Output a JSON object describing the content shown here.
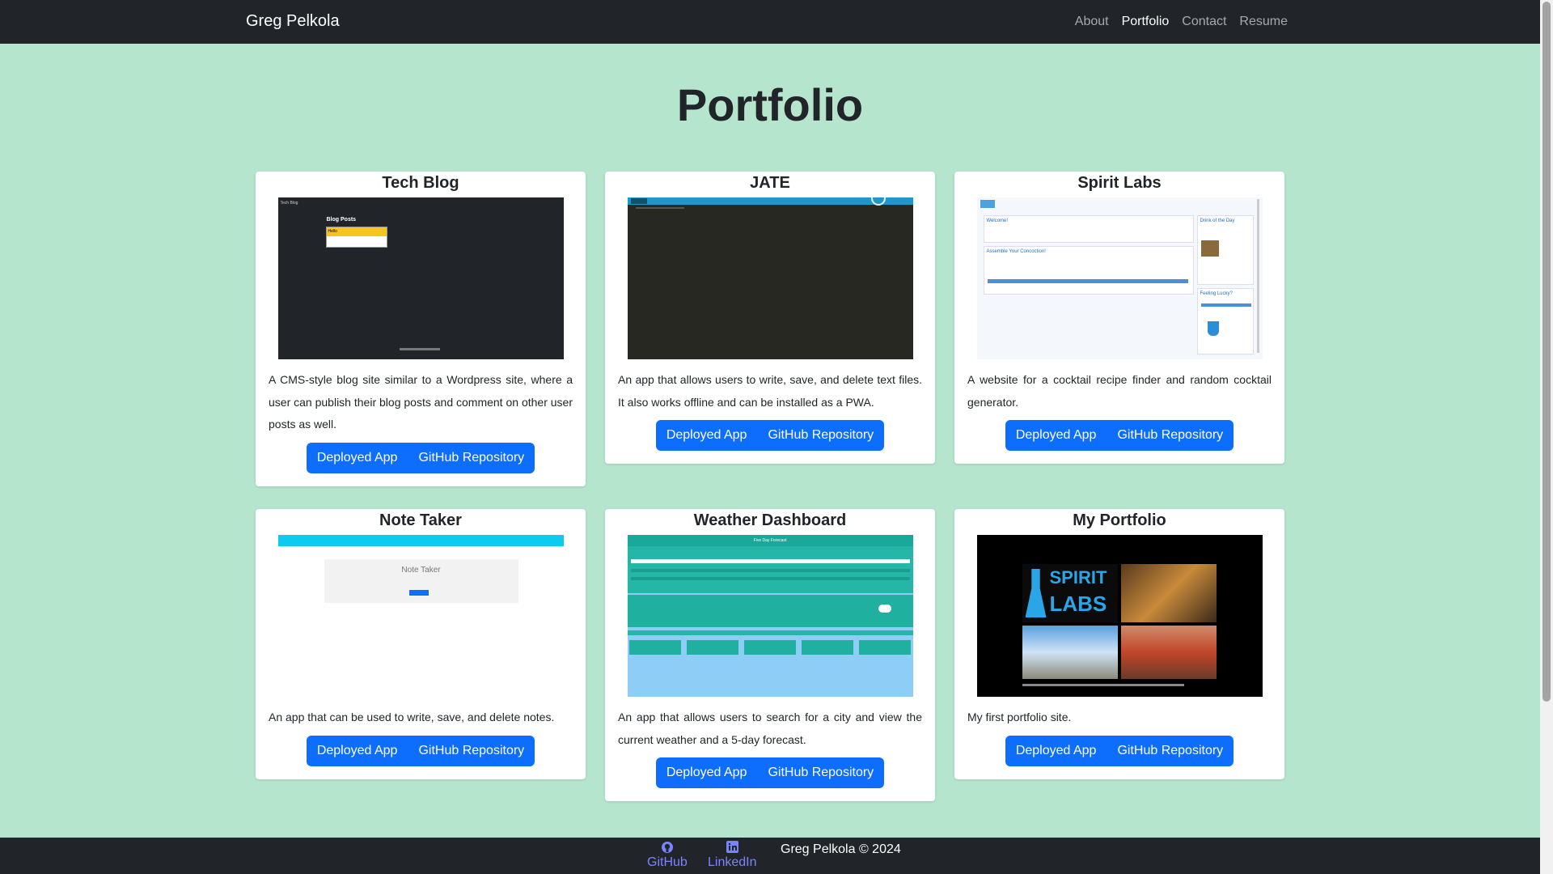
{
  "navbar": {
    "brand": "Greg Pelkola",
    "links": [
      {
        "label": "About",
        "active": false
      },
      {
        "label": "Portfolio",
        "active": true
      },
      {
        "label": "Contact",
        "active": false
      },
      {
        "label": "Resume",
        "active": false
      }
    ]
  },
  "page": {
    "title": "Portfolio"
  },
  "projects": [
    {
      "title": "Tech Blog",
      "description": "A CMS-style blog site similar to a Wordpress site, where a user can publish their blog posts and comment on other user posts as well.",
      "deployed_label": "Deployed App",
      "repo_label": "GitHub Repository",
      "preview": {
        "nav_text": "Tech Blog",
        "heading": "Blog Posts",
        "item": "Hello"
      }
    },
    {
      "title": "JATE",
      "description": "An app that allows users to write, save, and delete text files. It also works offline and can be installed as a PWA.",
      "deployed_label": "Deployed App",
      "repo_label": "GitHub Repository"
    },
    {
      "title": "Spirit Labs",
      "description": "A website for a cocktail recipe finder and random cocktail generator.",
      "deployed_label": "Deployed App",
      "repo_label": "GitHub Repository",
      "preview": {
        "welcome": "Welcome!",
        "assemble": "Assemble Your Concoction!",
        "drink": "Drink of the Day",
        "lucky": "Feeling Lucky?"
      }
    },
    {
      "title": "Note Taker",
      "description": "An app that can be used to write, save, and delete notes.",
      "deployed_label": "Deployed App",
      "repo_label": "GitHub Repository",
      "preview": {
        "heading": "Note Taker"
      }
    },
    {
      "title": "Weather Dashboard",
      "description": "An app that allows users to search for a city and view the current weather and a 5-day forecast.",
      "deployed_label": "Deployed App",
      "repo_label": "GitHub Repository",
      "preview": {
        "heading": "Five Day Forecast"
      }
    },
    {
      "title": "My Portfolio",
      "description": "My first portfolio site.",
      "deployed_label": "Deployed App",
      "repo_label": "GitHub Repository",
      "preview": {
        "logo_line1": "SPIRIT",
        "logo_line2": "LABS"
      }
    }
  ],
  "footer": {
    "github_label": "GitHub",
    "linkedin_label": "LinkedIn",
    "copyright": "Greg Pelkola © 2024",
    "link_color": "#7b84ff"
  },
  "colors": {
    "page_bg": "#b5e5cd",
    "nav_bg": "#212529",
    "button": "#0d6efd"
  }
}
